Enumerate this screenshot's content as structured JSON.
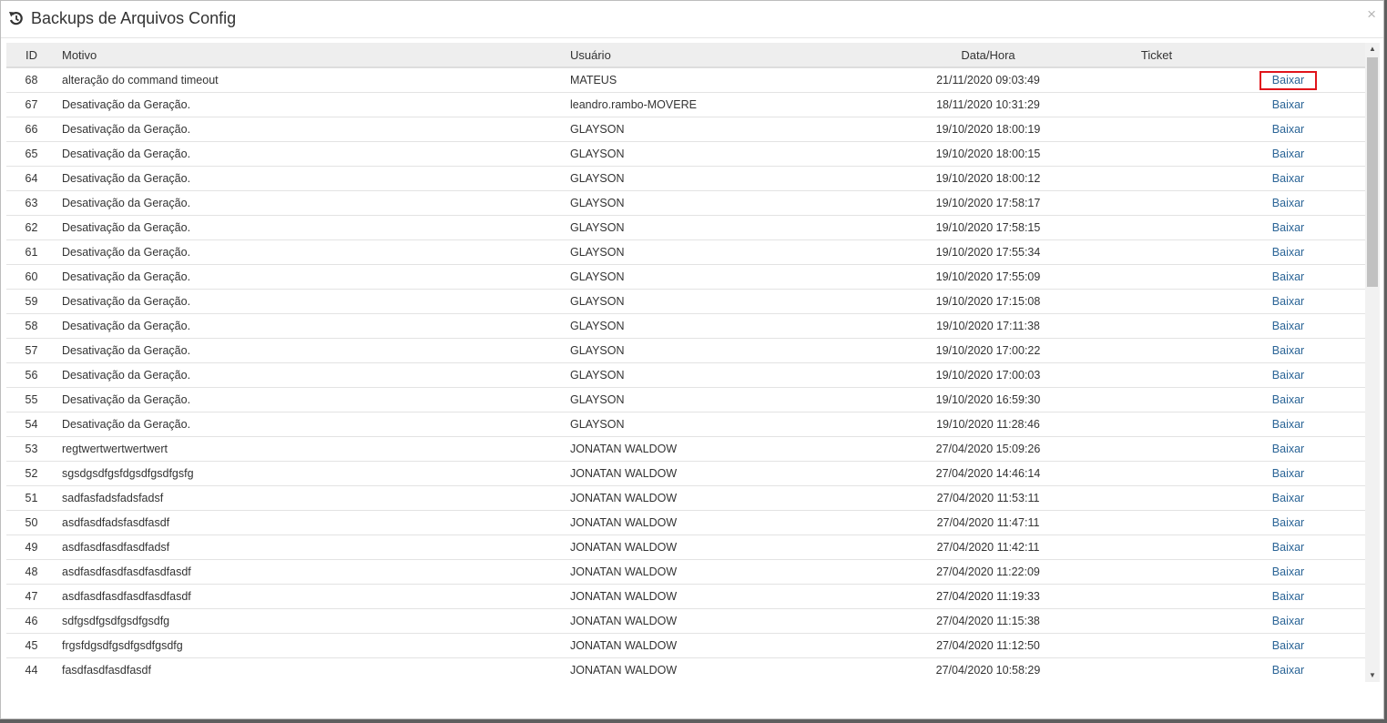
{
  "modal": {
    "title": "Backups de Arquivos Config",
    "close_glyph": "×"
  },
  "table": {
    "headers": {
      "id": "ID",
      "motivo": "Motivo",
      "usuario": "Usuário",
      "data_hora": "Data/Hora",
      "ticket": "Ticket"
    },
    "action_label": "Baixar",
    "rows": [
      {
        "id": "68",
        "motivo": "alteração do command timeout",
        "usuario": "MATEUS",
        "data_hora": "21/11/2020 09:03:49",
        "ticket": ""
      },
      {
        "id": "67",
        "motivo": "Desativação da Geração.",
        "usuario": "leandro.rambo-MOVERE",
        "data_hora": "18/11/2020 10:31:29",
        "ticket": ""
      },
      {
        "id": "66",
        "motivo": "Desativação da Geração.",
        "usuario": "GLAYSON",
        "data_hora": "19/10/2020 18:00:19",
        "ticket": ""
      },
      {
        "id": "65",
        "motivo": "Desativação da Geração.",
        "usuario": "GLAYSON",
        "data_hora": "19/10/2020 18:00:15",
        "ticket": ""
      },
      {
        "id": "64",
        "motivo": "Desativação da Geração.",
        "usuario": "GLAYSON",
        "data_hora": "19/10/2020 18:00:12",
        "ticket": ""
      },
      {
        "id": "63",
        "motivo": "Desativação da Geração.",
        "usuario": "GLAYSON",
        "data_hora": "19/10/2020 17:58:17",
        "ticket": ""
      },
      {
        "id": "62",
        "motivo": "Desativação da Geração.",
        "usuario": "GLAYSON",
        "data_hora": "19/10/2020 17:58:15",
        "ticket": ""
      },
      {
        "id": "61",
        "motivo": "Desativação da Geração.",
        "usuario": "GLAYSON",
        "data_hora": "19/10/2020 17:55:34",
        "ticket": ""
      },
      {
        "id": "60",
        "motivo": "Desativação da Geração.",
        "usuario": "GLAYSON",
        "data_hora": "19/10/2020 17:55:09",
        "ticket": ""
      },
      {
        "id": "59",
        "motivo": "Desativação da Geração.",
        "usuario": "GLAYSON",
        "data_hora": "19/10/2020 17:15:08",
        "ticket": ""
      },
      {
        "id": "58",
        "motivo": "Desativação da Geração.",
        "usuario": "GLAYSON",
        "data_hora": "19/10/2020 17:11:38",
        "ticket": ""
      },
      {
        "id": "57",
        "motivo": "Desativação da Geração.",
        "usuario": "GLAYSON",
        "data_hora": "19/10/2020 17:00:22",
        "ticket": ""
      },
      {
        "id": "56",
        "motivo": "Desativação da Geração.",
        "usuario": "GLAYSON",
        "data_hora": "19/10/2020 17:00:03",
        "ticket": ""
      },
      {
        "id": "55",
        "motivo": "Desativação da Geração.",
        "usuario": "GLAYSON",
        "data_hora": "19/10/2020 16:59:30",
        "ticket": ""
      },
      {
        "id": "54",
        "motivo": "Desativação da Geração.",
        "usuario": "GLAYSON",
        "data_hora": "19/10/2020 11:28:46",
        "ticket": ""
      },
      {
        "id": "53",
        "motivo": "regtwertwertwertwert",
        "usuario": "JONATAN WALDOW",
        "data_hora": "27/04/2020 15:09:26",
        "ticket": ""
      },
      {
        "id": "52",
        "motivo": "sgsdgsdfgsfdgsdfgsdfgsfg",
        "usuario": "JONATAN WALDOW",
        "data_hora": "27/04/2020 14:46:14",
        "ticket": ""
      },
      {
        "id": "51",
        "motivo": "sadfasfadsfadsfadsf",
        "usuario": "JONATAN WALDOW",
        "data_hora": "27/04/2020 11:53:11",
        "ticket": ""
      },
      {
        "id": "50",
        "motivo": "asdfasdfadsfasdfasdf",
        "usuario": "JONATAN WALDOW",
        "data_hora": "27/04/2020 11:47:11",
        "ticket": ""
      },
      {
        "id": "49",
        "motivo": "asdfasdfasdfasdfadsf",
        "usuario": "JONATAN WALDOW",
        "data_hora": "27/04/2020 11:42:11",
        "ticket": ""
      },
      {
        "id": "48",
        "motivo": "asdfasdfasdfasdfasdfasdf",
        "usuario": "JONATAN WALDOW",
        "data_hora": "27/04/2020 11:22:09",
        "ticket": ""
      },
      {
        "id": "47",
        "motivo": "asdfasdfasdfasdfasdfasdf",
        "usuario": "JONATAN WALDOW",
        "data_hora": "27/04/2020 11:19:33",
        "ticket": ""
      },
      {
        "id": "46",
        "motivo": "sdfgsdfgsdfgsdfgsdfg",
        "usuario": "JONATAN WALDOW",
        "data_hora": "27/04/2020 11:15:38",
        "ticket": ""
      },
      {
        "id": "45",
        "motivo": "frgsfdgsdfgsdfgsdfgsdfg",
        "usuario": "JONATAN WALDOW",
        "data_hora": "27/04/2020 11:12:50",
        "ticket": ""
      },
      {
        "id": "44",
        "motivo": "fasdfasdfasdfasdf",
        "usuario": "JONATAN WALDOW",
        "data_hora": "27/04/2020 10:58:29",
        "ticket": ""
      }
    ]
  },
  "highlighted_row_index": 0,
  "colors": {
    "link": "#2a6496",
    "highlight_border": "#e0141b",
    "header_bg": "#eeeeee"
  },
  "icons": {
    "title_icon": "history-icon",
    "scroll_up": "scroll-up-arrow-icon",
    "scroll_down": "scroll-down-arrow-icon"
  }
}
